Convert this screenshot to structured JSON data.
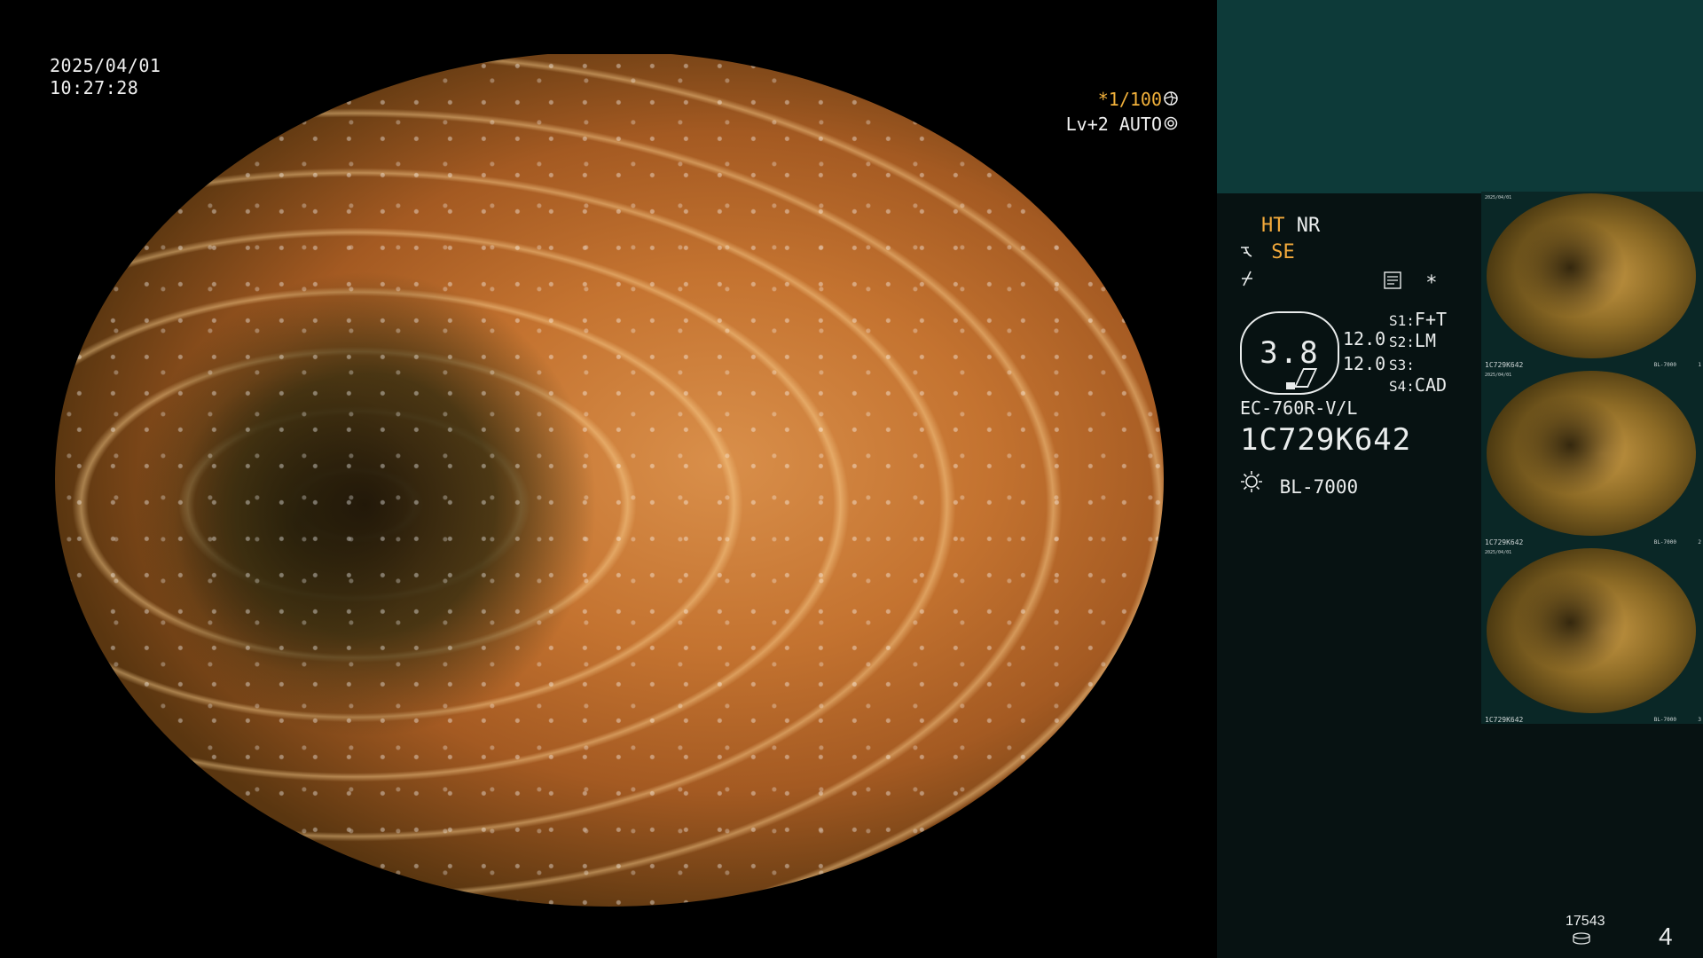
{
  "scope_view": {
    "date": "2025/04/01",
    "time": "10:27:28",
    "shutter": "*1/100",
    "iris": "Lv+2 AUTO"
  },
  "panel": {
    "ht": "HT",
    "nr": "NR",
    "se": "SE",
    "gauge_value": "3.8",
    "val_top": "12.0",
    "val_bottom": "12.0",
    "s1_label": "S1:",
    "s1_value": "F+T",
    "s2_label": "S2:",
    "s2_value": "LM",
    "s3_label": "S3:",
    "s3_value": "",
    "s4_label": "S4:",
    "s4_value": "CAD",
    "scope_model": "EC-760R-V/L",
    "scope_serial": "1C729K642",
    "light_source": "BL-7000",
    "asterisk": "*"
  },
  "thumbnails": [
    {
      "caption": "1C729K642",
      "date": "2025/04/01",
      "light": "BL-7000",
      "number": "1"
    },
    {
      "caption": "1C729K642",
      "date": "2025/04/01",
      "light": "BL-7000",
      "number": "2"
    },
    {
      "caption": "1C729K642",
      "date": "2025/04/01",
      "light": "BL-7000",
      "number": "3"
    }
  ],
  "footer": {
    "counter": "17543",
    "page": "4"
  },
  "colors": {
    "accent_orange": "#f2a93b",
    "panel_bg": "#071212",
    "panel_header": "#0d3a39"
  },
  "icons": {
    "iris": "iris-icon",
    "settings": "gear-icon",
    "structure": "structure-enhancement-icon",
    "edge": "edge-icon",
    "memo": "memo-icon",
    "light": "light-source-icon",
    "storage": "storage-icon"
  }
}
